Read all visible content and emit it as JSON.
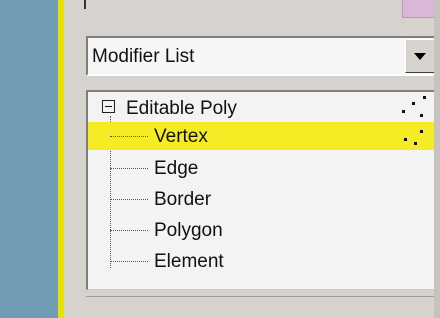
{
  "modifier_dropdown": {
    "selected": "Modifier List"
  },
  "modifier_stack": {
    "root": {
      "label": "Editable Poly",
      "expanded": true
    },
    "sub_objects": [
      {
        "label": "Vertex",
        "selected": true
      },
      {
        "label": "Edge",
        "selected": false
      },
      {
        "label": "Border",
        "selected": false
      },
      {
        "label": "Polygon",
        "selected": false
      },
      {
        "label": "Element",
        "selected": false
      }
    ]
  },
  "colors": {
    "left_strip": "#6f9bb4",
    "accent_bar": "#e7e000",
    "selection": "#f5ec26",
    "panel": "#d6d3ce",
    "top_swatch": "#d9b7d8"
  },
  "icons": {
    "expand_toggle": "minus-box-icon",
    "dropdown_button": "chevron-down-icon",
    "subobject_indicator": "vertex-dots-icon"
  }
}
